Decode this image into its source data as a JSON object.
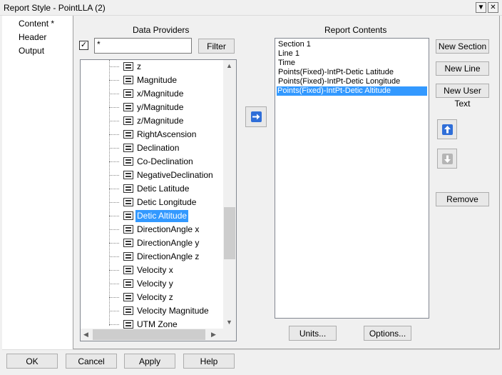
{
  "window": {
    "title": "Report Style - PointLLA (2)",
    "menu_glyph": "▼",
    "close_glyph": "✕"
  },
  "nav": {
    "items": [
      {
        "label": "Content *"
      },
      {
        "label": "Header"
      },
      {
        "label": "Output"
      }
    ]
  },
  "providers": {
    "heading": "Data Providers",
    "checkbox_mark": "✓",
    "filter_value": "*",
    "filter_button": "Filter",
    "items": [
      {
        "label": "z",
        "selected": false
      },
      {
        "label": "Magnitude",
        "selected": false
      },
      {
        "label": "x/Magnitude",
        "selected": false
      },
      {
        "label": "y/Magnitude",
        "selected": false
      },
      {
        "label": "z/Magnitude",
        "selected": false
      },
      {
        "label": "RightAscension",
        "selected": false
      },
      {
        "label": "Declination",
        "selected": false
      },
      {
        "label": "Co-Declination",
        "selected": false
      },
      {
        "label": "NegativeDeclination",
        "selected": false
      },
      {
        "label": "Detic Latitude",
        "selected": false
      },
      {
        "label": "Detic Longitude",
        "selected": false
      },
      {
        "label": "Detic Altitude",
        "selected": true
      },
      {
        "label": "DirectionAngle x",
        "selected": false
      },
      {
        "label": "DirectionAngle y",
        "selected": false
      },
      {
        "label": "DirectionAngle z",
        "selected": false
      },
      {
        "label": "Velocity x",
        "selected": false
      },
      {
        "label": "Velocity y",
        "selected": false
      },
      {
        "label": "Velocity z",
        "selected": false
      },
      {
        "label": "Velocity Magnitude",
        "selected": false
      },
      {
        "label": "UTM Zone",
        "selected": false
      }
    ]
  },
  "contents": {
    "heading": "Report Contents",
    "items": [
      {
        "label": "Section 1",
        "selected": false
      },
      {
        "label": "Line 1",
        "selected": false
      },
      {
        "label": "Time",
        "selected": false
      },
      {
        "label": "Points(Fixed)-IntPt-Detic Latitude",
        "selected": false
      },
      {
        "label": "Points(Fixed)-IntPt-Detic Longitude",
        "selected": false
      },
      {
        "label": "Points(Fixed)-IntPt-Detic Altitude",
        "selected": true
      }
    ],
    "units_button": "Units...",
    "options_button": "Options..."
  },
  "actions": {
    "new_section": "New Section",
    "new_line": "New Line",
    "new_user_text": "New User Text",
    "remove": "Remove"
  },
  "footer": {
    "ok": "OK",
    "cancel": "Cancel",
    "apply": "Apply",
    "help": "Help"
  },
  "colors": {
    "selection": "#3399ff",
    "arrow_blue": "#2f6ed8"
  }
}
